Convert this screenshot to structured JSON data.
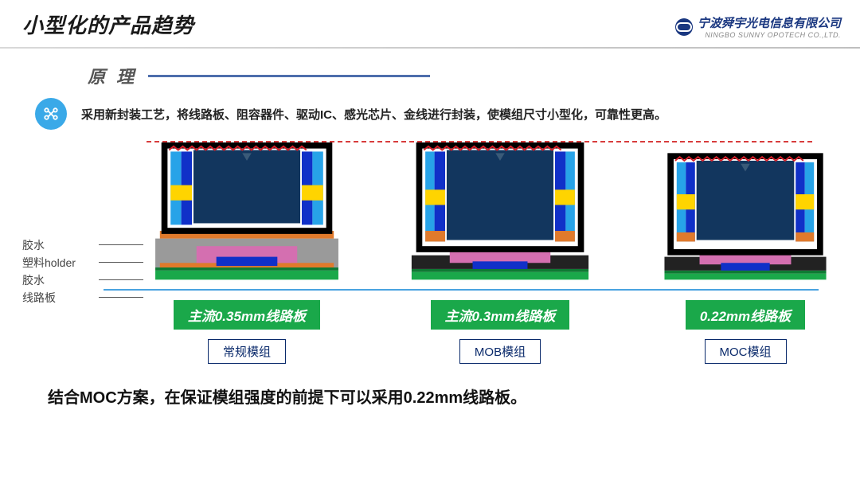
{
  "title": "小型化的产品趋势",
  "brand": {
    "cn": "宁波舜宇光电信息有限公司",
    "en": "NINGBO SUNNY OPOTECH CO.,LTD."
  },
  "section_label": "原 理",
  "description": "采用新封装工艺，将线路板、阻容器件、驱动IC、感光芯片、金线进行封装，使模组尺寸小型化，可靠性更高。",
  "side_labels": {
    "a": "胶水",
    "b": "塑料holder",
    "c": "胶水",
    "d": "线路板"
  },
  "modules": [
    {
      "band": "主流0.35mm线路板",
      "tag": "常规模组"
    },
    {
      "band": "主流0.3mm线路板",
      "tag": "MOB模组"
    },
    {
      "band": "0.22mm线路板",
      "tag": "MOC模组"
    }
  ],
  "conclusion": "结合MOC方案，在保证模组强度的前提下可以采用0.22mm线路板。"
}
